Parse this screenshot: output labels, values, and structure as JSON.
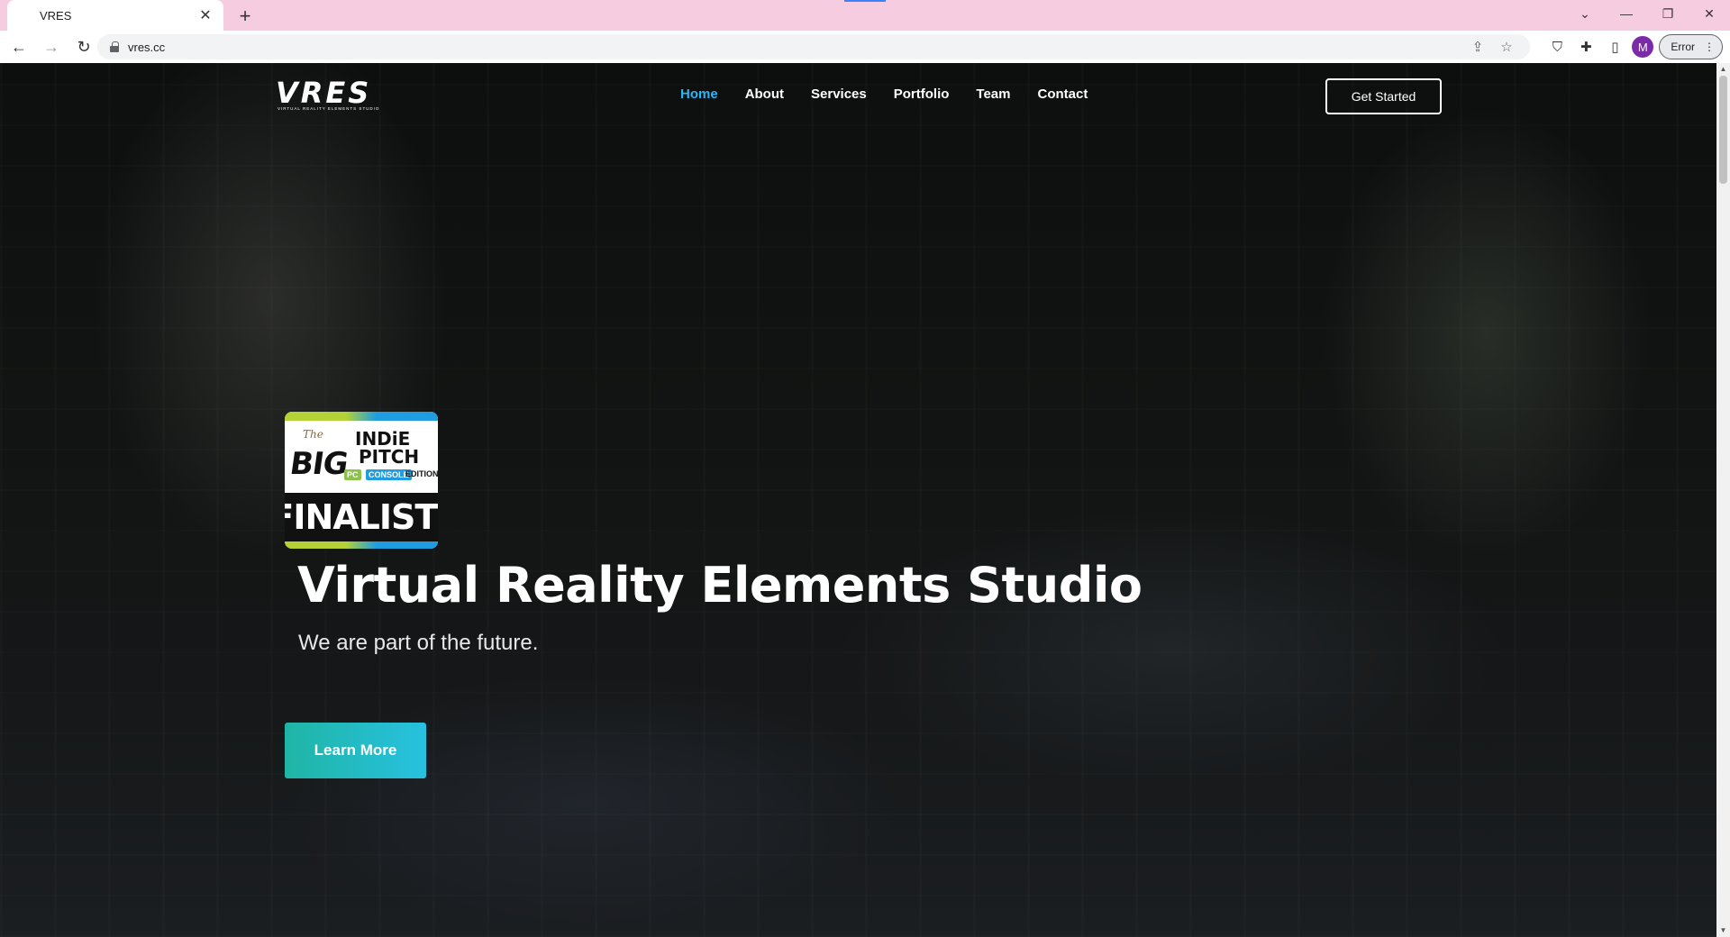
{
  "browser": {
    "tab_title": "VRES",
    "tab_close": "✕",
    "new_tab": "+",
    "url": "vres.cc",
    "profile_initial": "M",
    "error_label": "Error",
    "icons": {
      "back": "back-arrow-icon",
      "forward": "forward-arrow-icon",
      "reload": "reload-icon",
      "lock": "lock-icon",
      "share": "share-icon",
      "bookmark": "star-icon",
      "shield": "shield-icon",
      "extensions": "puzzle-icon",
      "sidepanel": "side-panel-icon",
      "menu": "kebab-menu-icon"
    },
    "glyphs": {
      "back": "←",
      "forward": "→",
      "reload": "↻",
      "share": "⇪",
      "star": "☆",
      "shield": "⛉",
      "puzzle": "✚",
      "sidepanel": "▯",
      "kebab": "⋮",
      "minimize": "—",
      "restore": "❐",
      "close": "✕",
      "chevron": "⌄"
    }
  },
  "site": {
    "logo_text": "VRES",
    "logo_subtitle": "VIRTUAL REALITY ELEMENTS STUDIO",
    "nav": [
      {
        "label": "Home",
        "active": true
      },
      {
        "label": "About"
      },
      {
        "label": "Services"
      },
      {
        "label": "Portfolio"
      },
      {
        "label": "Team"
      },
      {
        "label": "Contact"
      }
    ],
    "cta_label": "Get Started",
    "badge": {
      "the": "The",
      "big": "BIG",
      "indie": "INDiE",
      "pitch": "PITCH",
      "pc": "PC",
      "console": "CONSOLE",
      "edition": "EDITION",
      "finalist": "FINALIST!"
    },
    "hero_title": "Virtual Reality Elements Studio",
    "hero_subtitle": "We are part of the future.",
    "learn_more_label": "Learn More",
    "colors": {
      "nav_active": "#29b6f6",
      "button_gradient_start": "#1fb5a5",
      "button_gradient_end": "#27c1e0"
    }
  }
}
